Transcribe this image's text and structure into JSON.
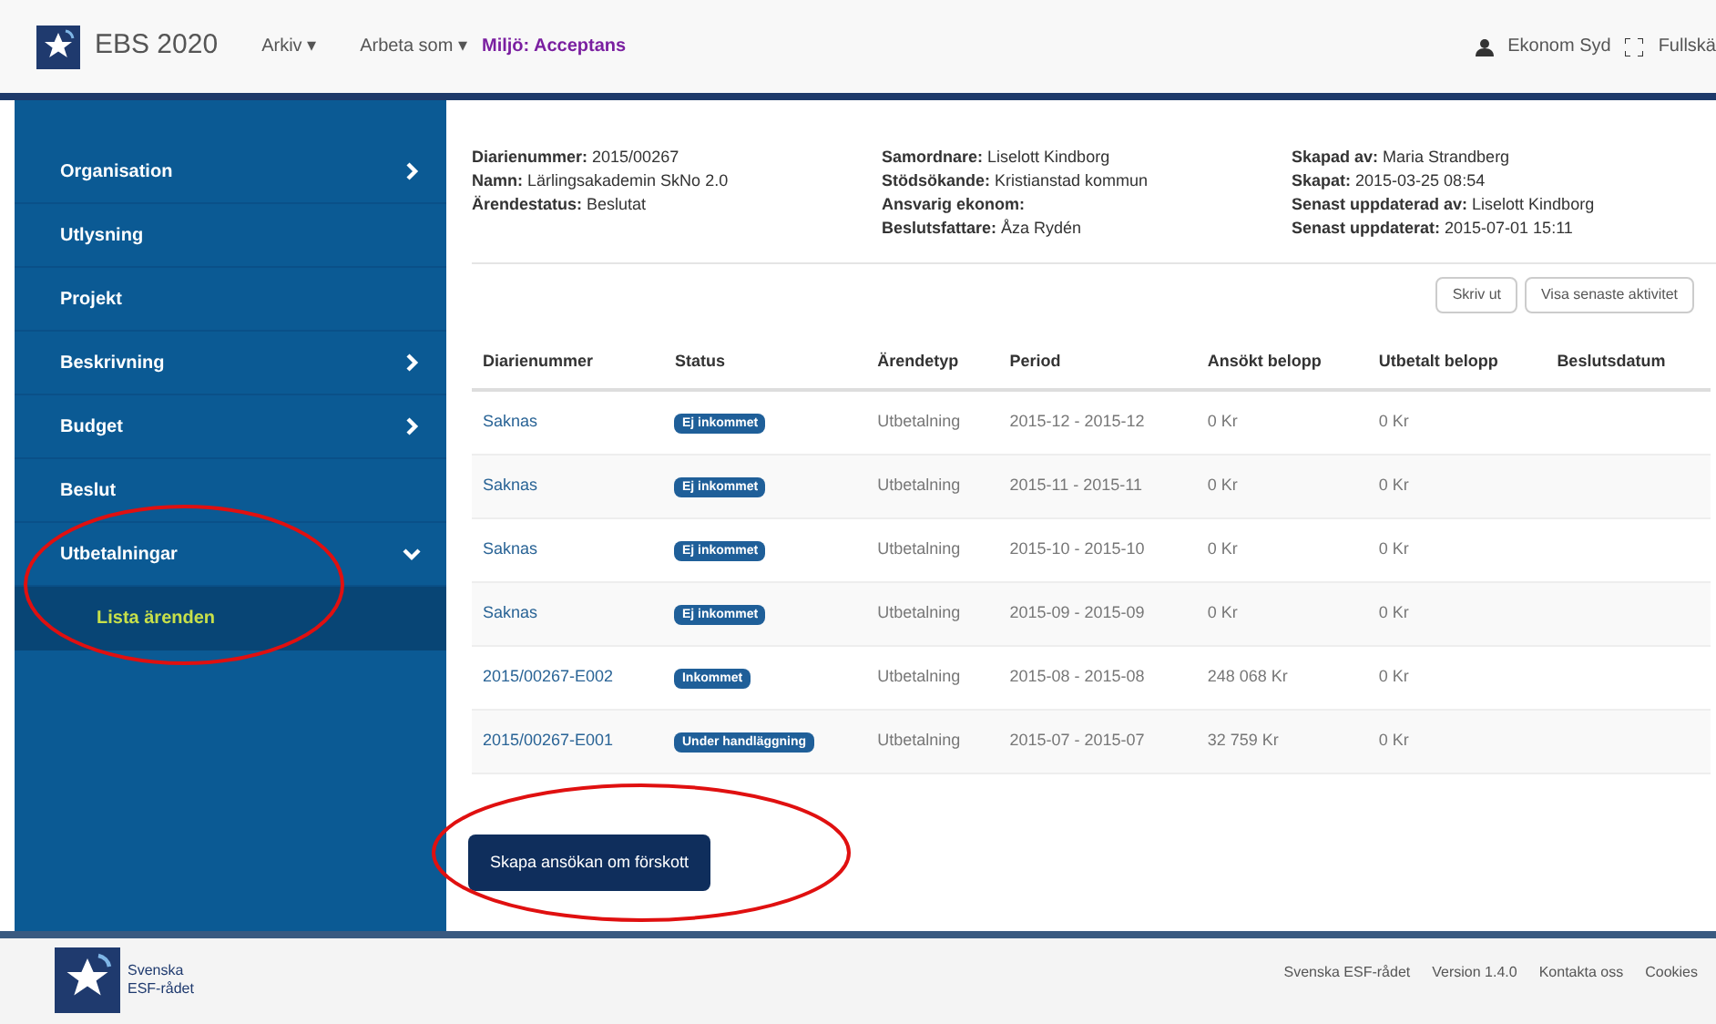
{
  "topbar": {
    "brand": "EBS 2020",
    "menus": [
      "Arkiv ▾",
      "Arbeta som ▾"
    ],
    "environment": "Miljö: Acceptans",
    "user": "Ekonom Syd",
    "fullscreen": "Fullskä"
  },
  "sidebar": {
    "items": [
      {
        "label": "Organisation",
        "kind": "group",
        "expanded": false
      },
      {
        "label": "Utlysning",
        "kind": "link"
      },
      {
        "label": "Projekt",
        "kind": "link"
      },
      {
        "label": "Beskrivning",
        "kind": "group",
        "expanded": false
      },
      {
        "label": "Budget",
        "kind": "group",
        "expanded": false
      },
      {
        "label": "Beslut",
        "kind": "link"
      },
      {
        "label": "Utbetalningar",
        "kind": "group",
        "expanded": true,
        "children": [
          {
            "label": "Lista ärenden",
            "selected": true
          }
        ]
      }
    ]
  },
  "details": {
    "columns": [
      [
        {
          "label": "Diarienummer:",
          "value": "2015/00267"
        },
        {
          "label": "Namn:",
          "value": "Lärlingsakademin SkNo 2.0"
        },
        {
          "label": "Ärendestatus:",
          "value": "Beslutat"
        }
      ],
      [
        {
          "label": "Samordnare:",
          "value": "Liselott Kindborg"
        },
        {
          "label": "Stödsökande:",
          "value": "Kristianstad kommun"
        },
        {
          "label": "Ansvarig ekonom:"
        },
        {
          "label": "Beslutsfattare:",
          "value": "Åza Rydén"
        }
      ],
      [
        {
          "label": "Skapad av:",
          "value": "Maria Strandberg"
        },
        {
          "label": "Skapat:",
          "value": "2015-03-25 08:54"
        },
        {
          "label": "Senast uppdaterad av:",
          "value": "Liselott Kindborg"
        },
        {
          "label": "Senast uppdaterat:",
          "value": "2015-07-01 15:11"
        }
      ]
    ]
  },
  "actions": [
    "Skriv ut",
    "Visa senaste aktivitet"
  ],
  "table": {
    "columns": [
      "Diarienummer",
      "Status",
      "Ärendetyp",
      "Period",
      "Ansökt belopp",
      "Utbetalt belopp",
      "Beslutsdatum"
    ],
    "rows": [
      {
        "id": "Saknas",
        "status": "Ej inkommet",
        "type": "Utbetalning",
        "period": "2015-12 - 2015-12",
        "applied": "0 Kr",
        "paid": "0 Kr"
      },
      {
        "id": "Saknas",
        "status": "Ej inkommet",
        "type": "Utbetalning",
        "period": "2015-11 - 2015-11",
        "applied": "0 Kr",
        "paid": "0 Kr"
      },
      {
        "id": "Saknas",
        "status": "Ej inkommet",
        "type": "Utbetalning",
        "period": "2015-10 - 2015-10",
        "applied": "0 Kr",
        "paid": "0 Kr"
      },
      {
        "id": "Saknas",
        "status": "Ej inkommet",
        "type": "Utbetalning",
        "period": "2015-09 - 2015-09",
        "applied": "0 Kr",
        "paid": "0 Kr"
      },
      {
        "id": "2015/00267-E002",
        "status": "Inkommet",
        "type": "Utbetalning",
        "period": "2015-08 - 2015-08",
        "applied": "248 068 Kr",
        "paid": "0 Kr"
      },
      {
        "id": "2015/00267-E001",
        "status": "Under handläggning",
        "type": "Utbetalning",
        "period": "2015-07 - 2015-07",
        "applied": "32 759 Kr",
        "paid": "0 Kr"
      }
    ]
  },
  "primary_button": "Skapa ansökan om förskott",
  "footer": {
    "logo_text": [
      "Svenska",
      "ESF-rådet"
    ],
    "links": [
      "Svenska ESF-rådet",
      "Version 1.4.0",
      "Kontakta oss",
      "Cookies"
    ]
  }
}
